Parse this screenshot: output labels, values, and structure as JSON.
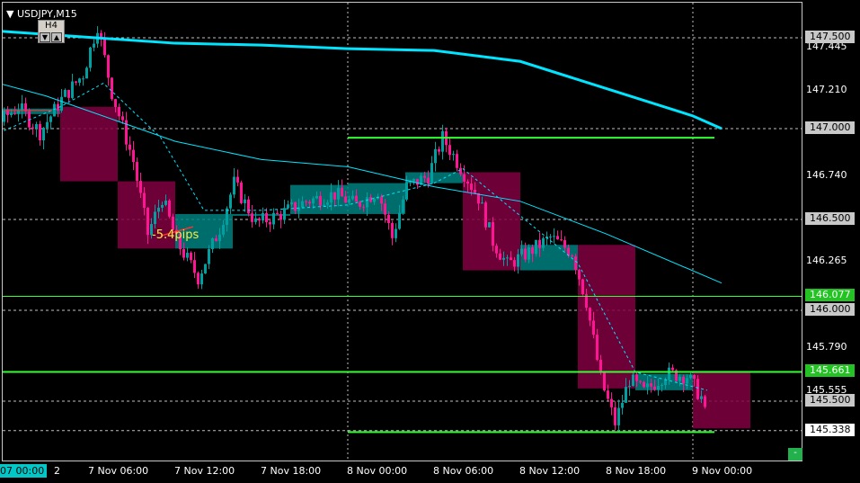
{
  "window": {
    "symbol_label": "▼ USDJPY,M15",
    "timeframe_label": "H4",
    "tf_down_arrow": "▼",
    "tf_up_arrow": "▲",
    "collapse_label": "-"
  },
  "annotation": {
    "pips_text": "-5.4pips"
  },
  "colors": {
    "bull": "#00a0a0",
    "bear": "#ff1493",
    "h4_bull_box": "#008080",
    "h4_bear_box": "#800040",
    "ma_slow": "#00e5ff",
    "ma_fast": "#00e5ff",
    "level_line": "#32ff32",
    "grid": "#c0c0c0",
    "tag_green": "#22c322",
    "tag_gray": "#c8c8c8",
    "tag_white": "#ffffff"
  },
  "price_axis": {
    "labels": [
      "147.445",
      "147.210",
      "146.740",
      "146.265",
      "145.790",
      "145.555"
    ],
    "tags": [
      {
        "text": "147.500",
        "style": "gray"
      },
      {
        "text": "147.000",
        "style": "gray"
      },
      {
        "text": "146.500",
        "style": "gray"
      },
      {
        "text": "146.077",
        "style": "green"
      },
      {
        "text": "146.000",
        "style": "gray"
      },
      {
        "text": "145.661",
        "style": "green"
      },
      {
        "text": "145.500",
        "style": "gray"
      },
      {
        "text": "145.338",
        "style": "white"
      }
    ]
  },
  "time_axis": {
    "first_label": "07 00:00",
    "first_suffix": "2",
    "labels": [
      "7 Nov 06:00",
      "7 Nov 12:00",
      "7 Nov 18:00",
      "8 Nov 00:00",
      "8 Nov 06:00",
      "8 Nov 12:00",
      "8 Nov 18:00",
      "9 Nov 00:00"
    ]
  },
  "chart_data": {
    "type": "candlestick",
    "symbol": "USDJPY",
    "timeframe": "M15",
    "ylim": [
      145.28,
      147.63
    ],
    "horizontal_levels": [
      147.5,
      147.0,
      146.5,
      146.077,
      146.0,
      145.661,
      145.5,
      145.338
    ],
    "day_separators": [
      "8 Nov 00:00",
      "9 Nov 00:00"
    ],
    "h4_boxes": [
      {
        "start": "6 Nov 20:00",
        "open": 146.96,
        "close": 147.1,
        "high": 147.12,
        "low": 146.96
      },
      {
        "start": "7 Nov 00:00",
        "open": 147.08,
        "close": 147.11,
        "high": 147.3,
        "low": 146.75
      },
      {
        "start": "7 Nov 04:00",
        "open": 147.12,
        "close": 146.71,
        "high": 147.58,
        "low": 146.71
      },
      {
        "start": "7 Nov 08:00",
        "open": 146.71,
        "close": 146.34,
        "high": 146.72,
        "low": 146.26
      },
      {
        "start": "7 Nov 12:00",
        "open": 146.34,
        "close": 146.53,
        "high": 146.74,
        "low": 146.13
      },
      {
        "start": "7 Nov 16:00",
        "open": 146.53,
        "close": 146.53,
        "high": 146.74,
        "low": 146.43
      },
      {
        "start": "7 Nov 20:00",
        "open": 146.53,
        "close": 146.69,
        "high": 146.74,
        "low": 146.47
      },
      {
        "start": "8 Nov 00:00",
        "open": 146.53,
        "close": 146.7,
        "high": 146.72,
        "low": 146.32
      },
      {
        "start": "8 Nov 04:00",
        "open": 146.7,
        "close": 146.76,
        "high": 146.78,
        "low": 146.6
      },
      {
        "start": "8 Nov 08:00",
        "open": 146.76,
        "close": 146.22,
        "high": 146.96,
        "low": 146.21
      },
      {
        "start": "8 Nov 12:00",
        "open": 146.22,
        "close": 146.36,
        "high": 146.42,
        "low": 146.17
      },
      {
        "start": "8 Nov 16:00",
        "open": 146.36,
        "close": 145.57,
        "high": 146.36,
        "low": 145.34
      },
      {
        "start": "8 Nov 20:00",
        "open": 145.56,
        "close": 145.65,
        "high": 145.68,
        "low": 145.36
      },
      {
        "start": "9 Nov 00:00",
        "open": 145.66,
        "close": 145.35,
        "high": 145.67,
        "low": 145.34
      }
    ],
    "m15_path": [
      [
        "6 Nov 19:00",
        146.95
      ],
      [
        "6 Nov 21:00",
        147.04
      ],
      [
        "6 Nov 23:00",
        147.0
      ],
      [
        "7 Nov 01:00",
        147.12
      ],
      [
        "7 Nov 02:30",
        146.98
      ],
      [
        "7 Nov 04:00",
        147.16
      ],
      [
        "7 Nov 05:30",
        147.3
      ],
      [
        "7 Nov 06:30",
        147.57
      ],
      [
        "7 Nov 07:30",
        147.2
      ],
      [
        "7 Nov 09:00",
        146.82
      ],
      [
        "7 Nov 10:00",
        146.42
      ],
      [
        "7 Nov 11:00",
        146.62
      ],
      [
        "7 Nov 12:00",
        146.38
      ],
      [
        "7 Nov 13:30",
        146.18
      ],
      [
        "7 Nov 15:00",
        146.45
      ],
      [
        "7 Nov 16:00",
        146.7
      ],
      [
        "7 Nov 17:30",
        146.48
      ],
      [
        "7 Nov 19:00",
        146.52
      ],
      [
        "7 Nov 21:00",
        146.6
      ],
      [
        "7 Nov 23:00",
        146.64
      ],
      [
        "8 Nov 00:30",
        146.58
      ],
      [
        "8 Nov 02:00",
        146.66
      ],
      [
        "8 Nov 03:00",
        146.4
      ],
      [
        "8 Nov 04:00",
        146.68
      ],
      [
        "8 Nov 05:30",
        146.74
      ],
      [
        "8 Nov 06:30",
        146.95
      ],
      [
        "8 Nov 07:30",
        146.82
      ],
      [
        "8 Nov 09:00",
        146.62
      ],
      [
        "8 Nov 10:00",
        146.38
      ],
      [
        "8 Nov 11:00",
        146.25
      ],
      [
        "8 Nov 12:30",
        146.32
      ],
      [
        "8 Nov 14:00",
        146.4
      ],
      [
        "8 Nov 15:30",
        146.32
      ],
      [
        "8 Nov 16:30",
        146.05
      ],
      [
        "8 Nov 17:30",
        145.62
      ],
      [
        "8 Nov 18:30",
        145.38
      ],
      [
        "8 Nov 19:30",
        145.62
      ],
      [
        "8 Nov 20:30",
        145.55
      ],
      [
        "8 Nov 22:00",
        145.65
      ],
      [
        "8 Nov 23:30",
        145.64
      ],
      [
        "9 Nov 00:30",
        145.52
      ],
      [
        "9 Nov 01:00",
        145.34
      ]
    ],
    "ma_slow": [
      [
        "6 Nov 12:00",
        147.6
      ],
      [
        "7 Nov 12:00",
        147.47
      ],
      [
        "7 Nov 18:00",
        147.46
      ],
      [
        "8 Nov 00:00",
        147.44
      ],
      [
        "8 Nov 06:00",
        147.43
      ],
      [
        "8 Nov 12:00",
        147.37
      ],
      [
        "8 Nov 18:00",
        147.22
      ],
      [
        "9 Nov 00:00",
        147.07
      ],
      [
        "9 Nov 02:00",
        147.0
      ]
    ],
    "ma_mid": [
      [
        "6 Nov 19:00",
        147.35
      ],
      [
        "7 Nov 03:00",
        147.18
      ],
      [
        "7 Nov 12:00",
        146.93
      ],
      [
        "7 Nov 18:00",
        146.83
      ],
      [
        "8 Nov 00:00",
        146.79
      ],
      [
        "8 Nov 06:00",
        146.68
      ],
      [
        "8 Nov 12:00",
        146.6
      ],
      [
        "8 Nov 18:00",
        146.42
      ],
      [
        "9 Nov 02:00",
        146.15
      ]
    ],
    "ma_fast": [
      [
        "6 Nov 22:00",
        146.92
      ],
      [
        "7 Nov 04:00",
        147.12
      ],
      [
        "7 Nov 07:00",
        147.25
      ],
      [
        "7 Nov 11:00",
        146.95
      ],
      [
        "7 Nov 14:00",
        146.55
      ],
      [
        "7 Nov 18:00",
        146.55
      ],
      [
        "8 Nov 00:00",
        146.58
      ],
      [
        "8 Nov 06:00",
        146.7
      ],
      [
        "8 Nov 08:00",
        146.78
      ],
      [
        "8 Nov 12:00",
        146.52
      ],
      [
        "8 Nov 16:00",
        146.26
      ],
      [
        "8 Nov 20:00",
        145.66
      ],
      [
        "9 Nov 01:00",
        145.56
      ]
    ],
    "level_lines_short": [
      {
        "price": 146.95,
        "from": "8 Nov 00:00",
        "to": "9 Nov 01:30"
      },
      {
        "price": 145.33,
        "from": "8 Nov 00:00",
        "to": "9 Nov 01:30"
      }
    ],
    "level_lines_full": [
      146.077,
      145.661
    ],
    "pips_marker": {
      "from": [
        "7 Nov 11:00",
        146.41
      ],
      "to": [
        "7 Nov 12:00",
        146.46
      ],
      "text_price": 146.41
    }
  }
}
